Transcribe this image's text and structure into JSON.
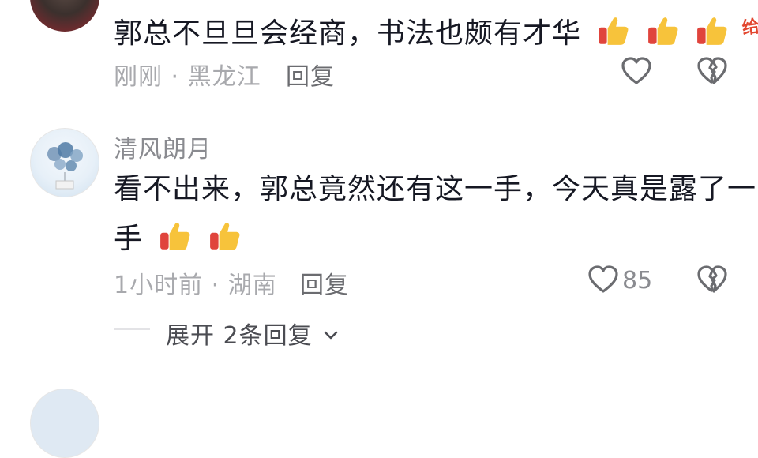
{
  "comments": [
    {
      "text": "郭总不旦旦会经商，书法也颇有才华",
      "meta": "刚刚 · 黑龙江",
      "reply_label": "回复",
      "sticker_text": "给力",
      "reactions": [
        "thumbs-up-icon",
        "thumbs-up-icon",
        "thumbs-up-icon"
      ]
    },
    {
      "username": "清风朗月",
      "text_line1": "看不出来，郭总竟然还有这一手，今天真是露了一",
      "text_line2": "手",
      "meta": "1小时前 · 湖南",
      "reply_label": "回复",
      "like_count": "85",
      "expand_label": "展开 2条回复"
    }
  ],
  "colors": {
    "text_primary": "#161823",
    "text_meta": "#a8a9ad",
    "text_reply": "#6b6c70",
    "thumb_yellow": "#f7c33b",
    "thumb_red": "#e0443c"
  }
}
